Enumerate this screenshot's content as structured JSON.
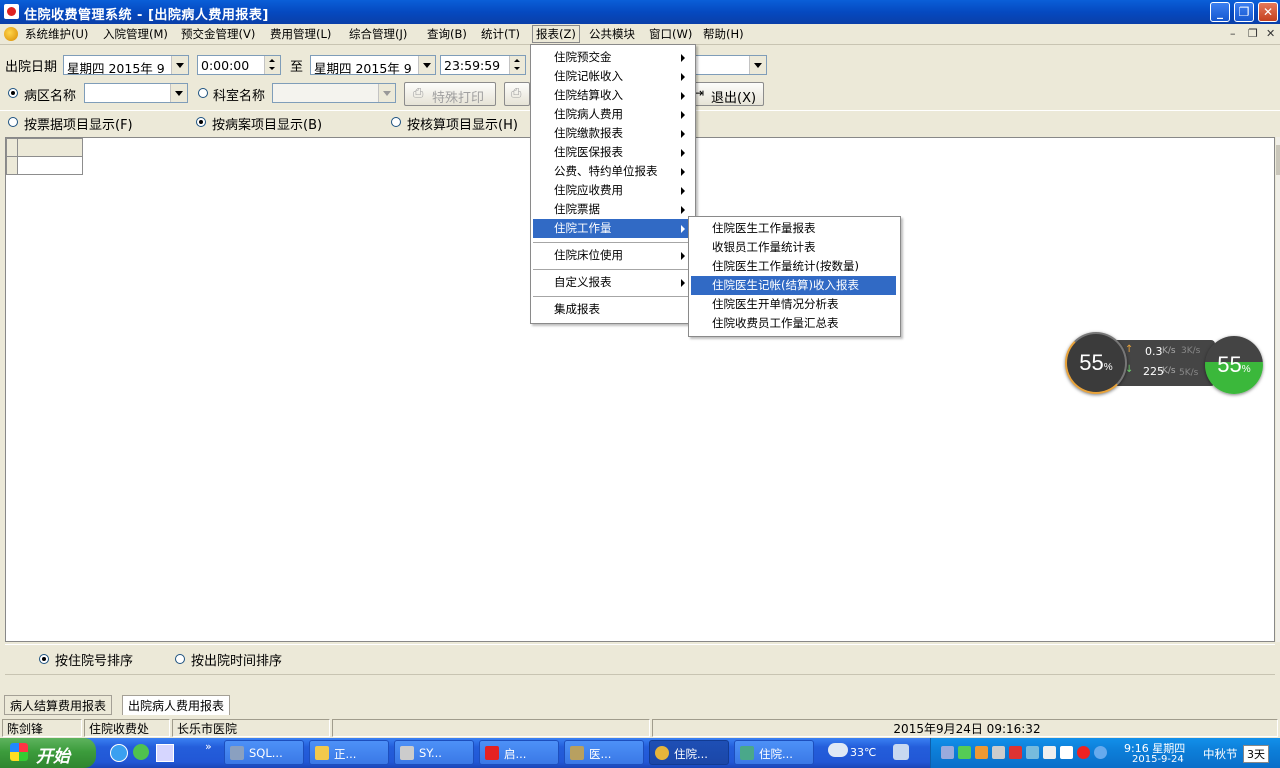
{
  "window": {
    "title": "住院收费管理系统 - [出院病人费用报表]"
  },
  "menubar": {
    "items": [
      "系统维护(U)",
      "入院管理(M)",
      "预交金管理(V)",
      "费用管理(L)",
      "综合管理(J)",
      "查询(B)",
      "统计(T)",
      "报表(Z)",
      "公共模块",
      "窗口(W)",
      "帮助(H)"
    ],
    "active_index": 7
  },
  "toolbar1": {
    "discharge_date_label": "出院日期",
    "from_date": "星期四  2015年 9",
    "from_time": "0:00:00",
    "to_label": "至",
    "to_date": "星期四  2015年 9",
    "to_time": "23:59:59"
  },
  "toolbar2": {
    "ward_label": "病区名称",
    "dept_label": "科室名称",
    "special_print_label": "特殊打印",
    "exit_label": "退出(X)",
    "ward_selected": true
  },
  "display_options": {
    "by_invoice": "按票据项目显示(F)",
    "by_case": "按病案项目显示(B)",
    "by_accounting": "按核算项目显示(H)",
    "selected": "by_case"
  },
  "report_menu": {
    "items": [
      "住院预交金",
      "住院记帐收入",
      "住院结算收入",
      "住院病人费用",
      "住院缴款报表",
      "住院医保报表",
      "公费、特约单位报表",
      "住院应收费用",
      "住院票据",
      "住院工作量",
      "住院床位使用",
      "自定义报表",
      "集成报表"
    ],
    "has_submenu": [
      true,
      true,
      true,
      true,
      true,
      true,
      true,
      true,
      true,
      true,
      true,
      true,
      false
    ],
    "selected_index": 9
  },
  "workload_submenu": {
    "items": [
      "住院医生工作量报表",
      "收银员工作量统计表",
      "住院医生工作量统计(按数量)",
      "住院医生记帐(结算)收入报表",
      "住院医生开单情况分析表",
      "住院收费员工作量汇总表"
    ],
    "selected_index": 3
  },
  "speed_widget": {
    "cpu_left": "55",
    "cpu_right": "55",
    "percent_sign": "%",
    "upload": "0.3",
    "upload_unit": "K/s",
    "download": "225",
    "download_unit": "K/s",
    "ghost_up": "3K/s",
    "ghost_down": "5K/s"
  },
  "sort_options": {
    "by_inpatient_no": "按住院号排序",
    "by_discharge_time": "按出院时间排序",
    "selected": "by_inpatient_no"
  },
  "tabs": [
    "病人结算费用报表",
    "出院病人费用报表"
  ],
  "active_tab": 1,
  "statusbar": {
    "user": "陈剑锋",
    "department": "住院收费处",
    "hospital": "长乐市医院",
    "datetime": "2015年9月24日  09:16:32"
  },
  "taskbar": {
    "start_label": "开始",
    "buttons": [
      "SQL...",
      "正...",
      "SY...",
      "启...",
      "医...",
      "住院...",
      "住院...",
      "33℃"
    ],
    "active_index": 5,
    "clock_time": "9:16 星期四",
    "clock_date": "2015-9-24",
    "holiday_label": "中秋节",
    "holiday_days": "3天",
    "colors": {
      "start": "#3c9c3c",
      "taskbar": "#245edb",
      "tray": "#0d7fd9"
    }
  }
}
